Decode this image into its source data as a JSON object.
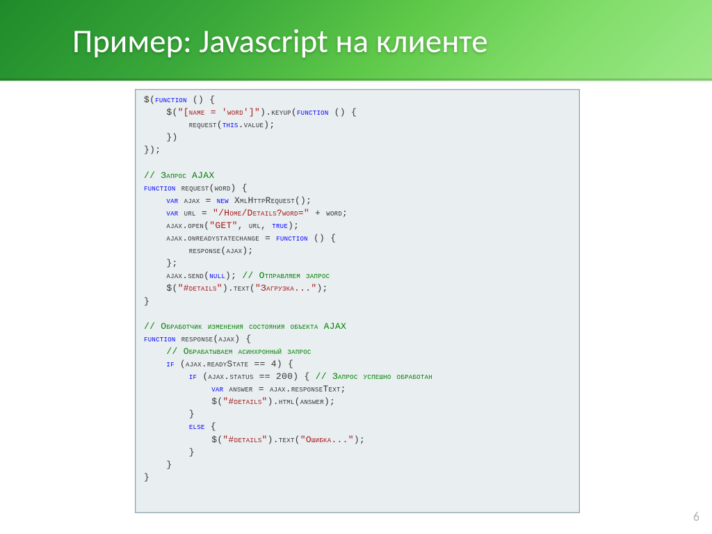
{
  "slide": {
    "title": "Пример: Javascript на клиенте",
    "page_number": "6"
  },
  "code": {
    "l1": "$(",
    "l1b": "function",
    "l1c": " () {",
    "l2a": "    $(",
    "l2s": "\"[name = 'word']\"",
    "l2b": ").keyup(",
    "l2k": "function",
    "l2c": " () {",
    "l3": "        request(",
    "l3k": "this",
    "l3b": ".value);",
    "l4": "    })",
    "l5": "});",
    "l6": "",
    "l7c": "// Запрос AJAX",
    "l8k": "function",
    "l8": " request(word) {",
    "l9a": "    ",
    "l9k": "var",
    "l9b": " ajax = ",
    "l9n": "new",
    "l9c": " XmlHttpRequest();",
    "l10a": "    ",
    "l10k": "var",
    "l10b": " url = ",
    "l10s": "\"/Home/Details?word=\"",
    "l10c": " + word;",
    "l11a": "    ajax.open(",
    "l11s": "\"GET\"",
    "l11b": ", url, ",
    "l11t": "true",
    "l11c": ");",
    "l12a": "    ajax.onreadystatechange = ",
    "l12k": "function",
    "l12b": " () {",
    "l13": "        response(ajax);",
    "l14": "    };",
    "l15a": "    ajax.send(",
    "l15n": "null",
    "l15b": "); ",
    "l15c": "// Отправляем запрос",
    "l16a": "    $(",
    "l16s": "\"#details\"",
    "l16b": ").text(",
    "l16t": "\"Загрузка...\"",
    "l16c": ");",
    "l17": "}",
    "l18": "",
    "l19c": "// Обработчик изменения состояния объекта AJAX",
    "l20k": "function",
    "l20": " response(ajax) {",
    "l21a": "    ",
    "l21c": "// Обрабатываем асинхронный запрос",
    "l22a": "    ",
    "l22k": "if",
    "l22b": " (ajax.readyState == 4) {",
    "l23a": "        ",
    "l23k": "if",
    "l23b": " (ajax.status == 200) { ",
    "l23c": "// Запрос успешно обработан",
    "l24a": "            ",
    "l24k": "var",
    "l24b": " answer = ajax.responseText;",
    "l25a": "            $(",
    "l25s": "\"#details\"",
    "l25b": ").html(answer);",
    "l26": "        }",
    "l27a": "        ",
    "l27k": "else",
    "l27b": " {",
    "l28a": "            $(",
    "l28s": "\"#details\"",
    "l28b": ").text(",
    "l28t": "\"Ошибка...\"",
    "l28c": ");",
    "l29": "        }",
    "l30": "    }",
    "l31": "}"
  }
}
